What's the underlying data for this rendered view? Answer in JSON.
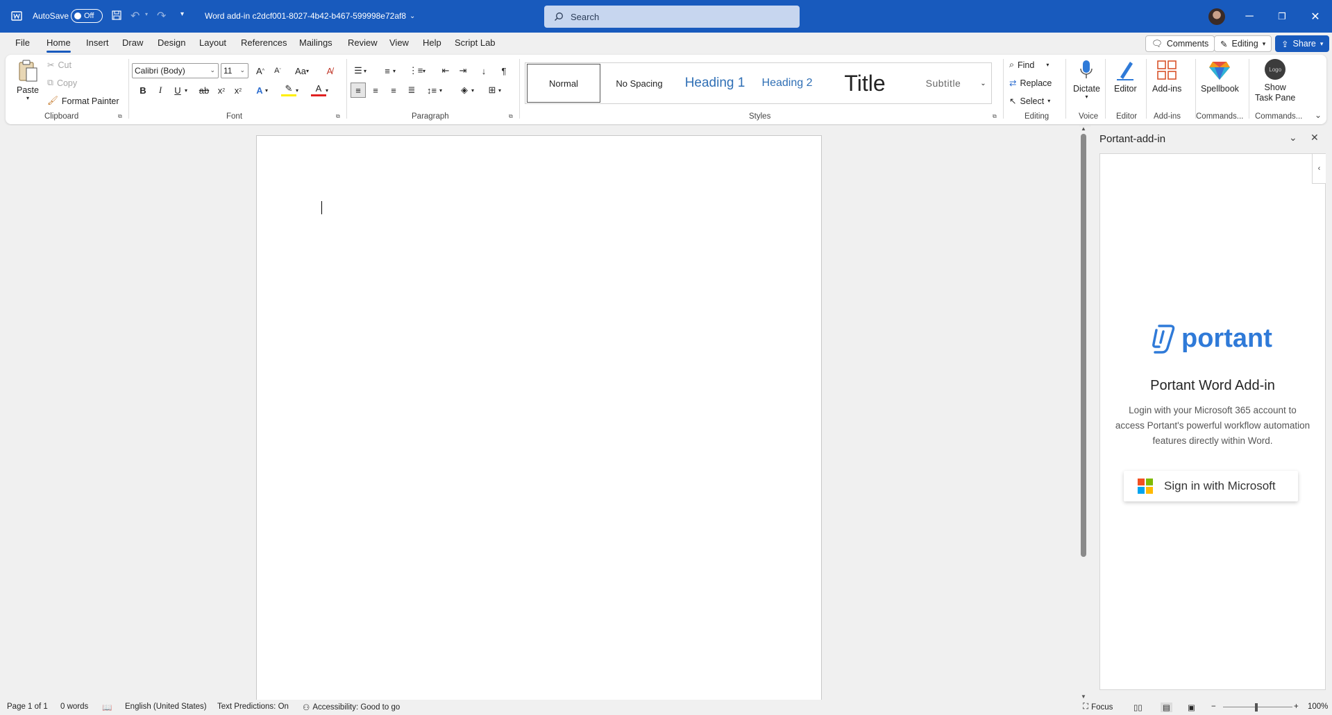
{
  "titlebar": {
    "autosave_label": "AutoSave",
    "autosave_state": "Off",
    "doc_title": "Word add-in c2dcf001-8027-4b42-b467-599998e72af8",
    "search_placeholder": "Search"
  },
  "tabs": [
    "File",
    "Home",
    "Insert",
    "Draw",
    "Design",
    "Layout",
    "References",
    "Mailings",
    "Review",
    "View",
    "Help",
    "Script Lab"
  ],
  "top_right": {
    "comments": "Comments",
    "editing": "Editing",
    "share": "Share"
  },
  "clipboard": {
    "paste": "Paste",
    "cut": "Cut",
    "copy": "Copy",
    "format_painter": "Format Painter",
    "label": "Clipboard"
  },
  "font": {
    "family": "Calibri (Body)",
    "size": "11",
    "label": "Font"
  },
  "paragraph": {
    "label": "Paragraph"
  },
  "styles": {
    "items": [
      "Normal",
      "No Spacing",
      "Heading 1",
      "Heading 2",
      "Title",
      "Subtitle"
    ],
    "label": "Styles"
  },
  "editing": {
    "find": "Find",
    "replace": "Replace",
    "select": "Select",
    "label": "Editing"
  },
  "voice": {
    "dictate": "Dictate",
    "label": "Voice"
  },
  "editor": {
    "btn": "Editor",
    "label": "Editor"
  },
  "addins": {
    "btn": "Add-ins",
    "label": "Add-ins"
  },
  "commands1": {
    "btn": "Spellbook",
    "label": "Commands..."
  },
  "commands2": {
    "btn_line1": "Show",
    "btn_line2": "Task Pane",
    "logo_text": "Logo",
    "label": "Commands..."
  },
  "pane": {
    "title": "Portant-add-in",
    "brand": "portant",
    "heading": "Portant Word Add-in",
    "description": "Login with your Microsoft 365 account to access Portant's powerful workflow automation features directly within Word.",
    "signin": "Sign in with Microsoft"
  },
  "status": {
    "page": "Page 1 of 1",
    "words": "0 words",
    "language": "English (United States)",
    "predictions": "Text Predictions: On",
    "accessibility": "Accessibility: Good to go",
    "focus": "Focus",
    "zoom": "100%"
  },
  "colors": {
    "brand_blue": "#185abd",
    "portant_blue": "#2f7ad8"
  }
}
